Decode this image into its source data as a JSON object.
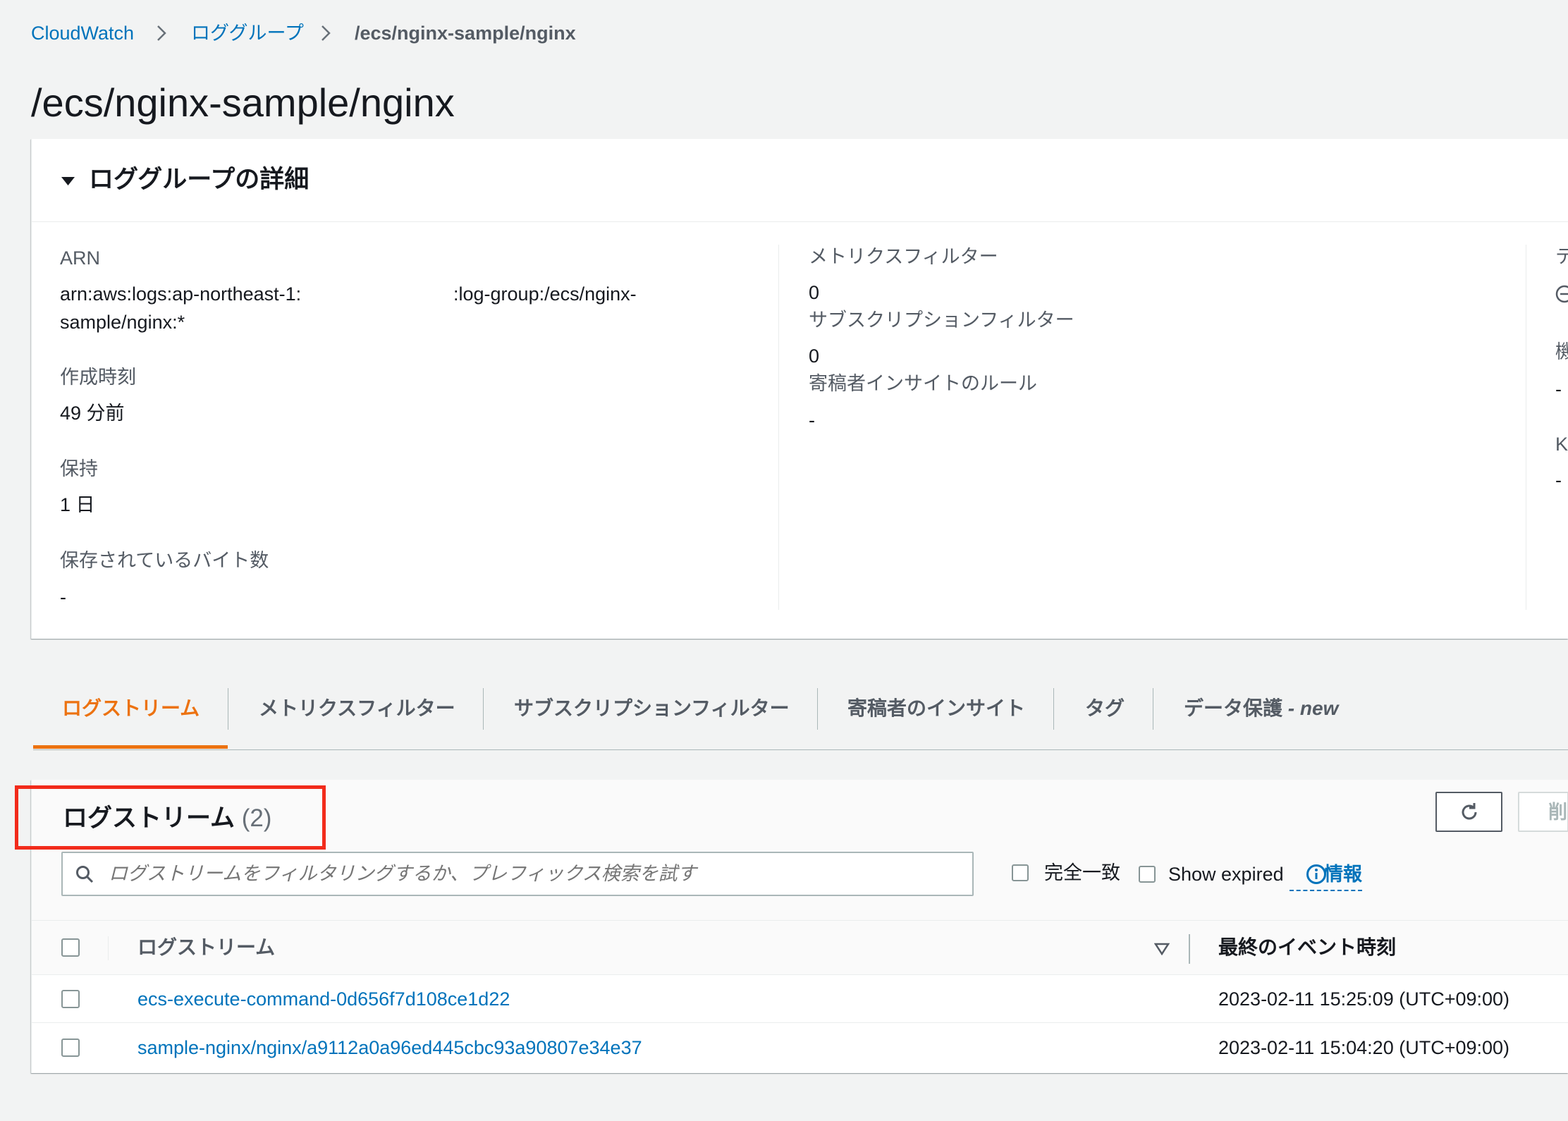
{
  "breadcrumb": [
    {
      "label": "CloudWatch"
    },
    {
      "label": "ロググループ"
    },
    {
      "label": "/ecs/nginx-sample/nginx"
    }
  ],
  "page_title": "/ecs/nginx-sample/nginx",
  "details": {
    "heading": "ロググループの詳細",
    "expanded": true,
    "arn": {
      "label": "ARN",
      "value_start": "arn:aws:logs:ap-northeast-1:",
      "value_end": ":log-group:/ecs/nginx-",
      "value_wrap": "sample/nginx:*"
    },
    "creation_time": {
      "label": "作成時刻",
      "value": "49 分前"
    },
    "retention": {
      "label": "保持",
      "value": "1 日"
    },
    "stored_bytes": {
      "label": "保存されているバイト数",
      "value": "-"
    },
    "metric_filters": {
      "label": "メトリクスフィルター",
      "value": "0"
    },
    "subscription_filters": {
      "label": "サブスクリプションフィルター",
      "value": "0"
    },
    "contributor_insights_rules": {
      "label": "寄稿者インサイトのルール",
      "value": "-"
    },
    "clipped_column": {
      "label_1": "テ",
      "icon_1": "circle-minus-icon",
      "label_2": "機",
      "value_2": "-",
      "label_3": "K",
      "value_3": "-"
    }
  },
  "tabs": [
    {
      "label": "ログストリーム",
      "active": true
    },
    {
      "label": "メトリクスフィルター",
      "active": false
    },
    {
      "label": "サブスクリプションフィルター",
      "active": false
    },
    {
      "label": "寄稿者のインサイト",
      "active": false
    },
    {
      "label": "タグ",
      "active": false
    },
    {
      "label": "データ保護",
      "suffix": "- new",
      "active": false
    }
  ],
  "log_streams": {
    "heading": "ログストリーム",
    "count": "(2)",
    "refresh_icon": "refresh-icon",
    "delete_button_clipped": "削",
    "search": {
      "icon": "search-icon",
      "placeholder": "ログストリームをフィルタリングするか、プレフィックス検索を試す"
    },
    "exact_match": {
      "label": "完全一致",
      "checked": false
    },
    "show_expired": {
      "label": "Show expired",
      "checked": false
    },
    "info": {
      "icon": "info-icon",
      "label": "情報"
    },
    "select_all_checked": false,
    "columns": [
      {
        "label": "ログストリーム",
        "sort_icon": "sort-descending-icon"
      },
      {
        "label": "最終のイベント時刻"
      }
    ],
    "rows": [
      {
        "name": "ecs-execute-command-0d656f7d108ce1d22",
        "last_event_time": "2023-02-11 15:25:09 (UTC+09:00)",
        "checked": false
      },
      {
        "name": "sample-nginx/nginx/a9112a0a96ed445cbc93a90807e34e37",
        "last_event_time": "2023-02-11 15:04:20 (UTC+09:00)",
        "checked": false
      }
    ]
  },
  "annotation": {
    "highlight_color": "#f22b1b"
  },
  "colors": {
    "background": "#f2f3f3",
    "link": "#0073bb",
    "active_tab": "#ec7211",
    "text": "#16191f",
    "muted": "#545b64"
  }
}
